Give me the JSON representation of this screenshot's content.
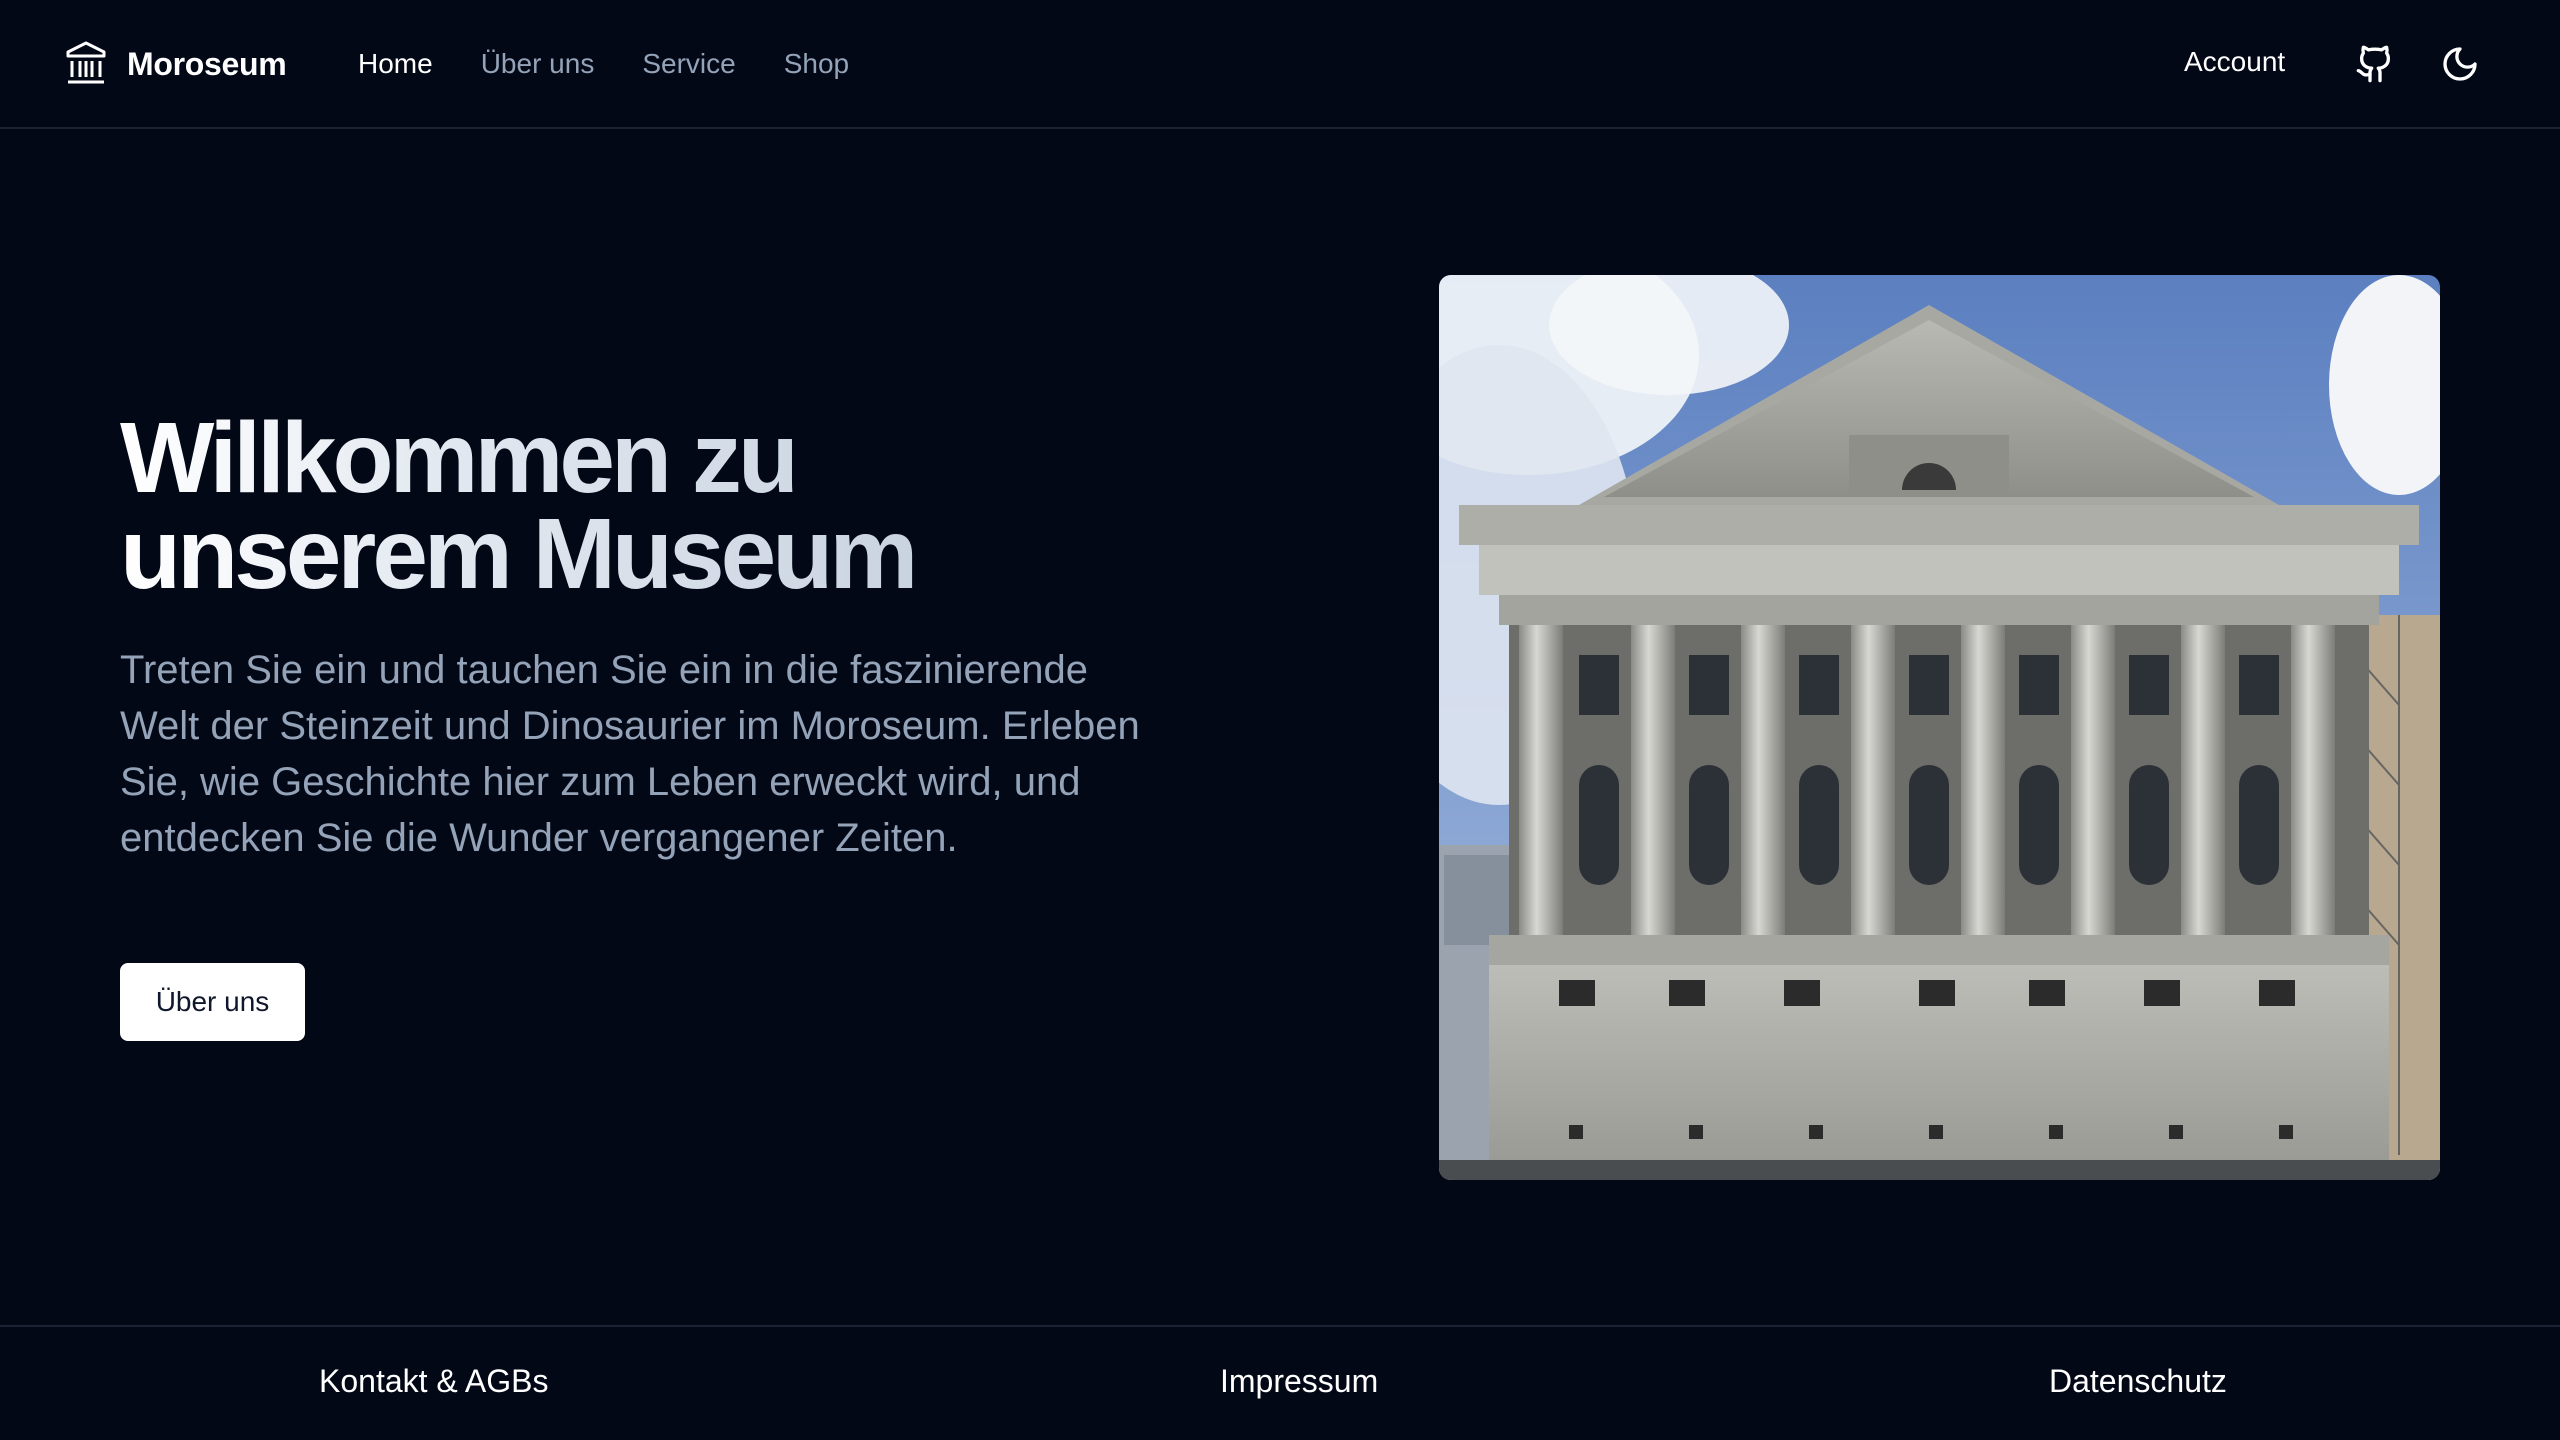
{
  "brand": {
    "name": "Moroseum",
    "icon": "museum-icon"
  },
  "nav": {
    "items": [
      {
        "label": "Home",
        "active": true
      },
      {
        "label": "Über uns",
        "active": false
      },
      {
        "label": "Service",
        "active": false
      },
      {
        "label": "Shop",
        "active": false
      }
    ]
  },
  "header_right": {
    "account_label": "Account",
    "github_icon": "github-icon",
    "theme_icon": "moon-icon"
  },
  "hero": {
    "title_line1": "Willkommen zu",
    "title_line2": "unserem Museum",
    "text": "Treten Sie ein und tauchen Sie ein in die faszinierende Welt der Steinzeit und Dinosaurier im Moroseum. Erleben Sie, wie Geschichte hier zum Leben erweckt wird, und entdecken Sie die Wunder vergangener Zeiten.",
    "button_label": "Über uns"
  },
  "footer": {
    "links": [
      "Kontakt & AGBs",
      "Impressum",
      "Datenschutz"
    ]
  },
  "colors": {
    "background": "#030817",
    "border": "#1b2233",
    "muted_text": "#94a3b8",
    "primary_text": "#ffffff"
  }
}
